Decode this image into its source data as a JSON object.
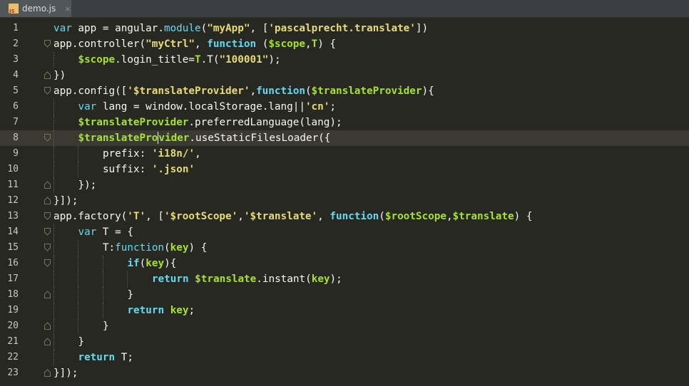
{
  "tab": {
    "filename": "demo.js",
    "close": "×",
    "icon": "js-file-icon"
  },
  "colors": {
    "background": "#272822",
    "keyword": "#66d9ef",
    "string": "#e6db74",
    "variable": "#a6e22e",
    "control": "#f92672",
    "text": "#f8f8f2"
  },
  "current_line": 8,
  "lines": [
    {
      "n": "1",
      "indent": 0,
      "fold": "",
      "tokens": [
        [
          "kw",
          "var"
        ],
        [
          "pl",
          " app = angular."
        ],
        [
          "kw",
          "module"
        ],
        [
          "pl",
          "("
        ],
        [
          "strb",
          "\"myApp\""
        ],
        [
          "pl",
          ", ["
        ],
        [
          "strb",
          "'pascalprecht.translate'"
        ],
        [
          "pl",
          "])"
        ]
      ]
    },
    {
      "n": "2",
      "indent": 0,
      "fold": "open",
      "tokens": [
        [
          "pl",
          "app.controller("
        ],
        [
          "strb",
          "\"myCtrl\""
        ],
        [
          "pl",
          ", "
        ],
        [
          "kwb",
          "function"
        ],
        [
          "pl",
          " ("
        ],
        [
          "varb",
          "$scope"
        ],
        [
          "pl",
          ","
        ],
        [
          "varb",
          "T"
        ],
        [
          "pl",
          ") {"
        ]
      ]
    },
    {
      "n": "3",
      "indent": 1,
      "fold": "",
      "tokens": [
        [
          "varb",
          "$scope"
        ],
        [
          "pl",
          ".login_title="
        ],
        [
          "varb",
          "T"
        ],
        [
          "pl",
          ".T("
        ],
        [
          "strb",
          "\"100001\""
        ],
        [
          "pl",
          ");"
        ]
      ]
    },
    {
      "n": "4",
      "indent": 0,
      "fold": "close",
      "tokens": [
        [
          "pl",
          "})"
        ]
      ]
    },
    {
      "n": "5",
      "indent": 0,
      "fold": "open",
      "tokens": [
        [
          "pl",
          "app.config(["
        ],
        [
          "strb",
          "'$translateProvider'"
        ],
        [
          "pl",
          ","
        ],
        [
          "kwb",
          "function"
        ],
        [
          "pl",
          "("
        ],
        [
          "varb",
          "$translateProvider"
        ],
        [
          "pl",
          "){"
        ]
      ]
    },
    {
      "n": "6",
      "indent": 1,
      "fold": "",
      "tokens": [
        [
          "kw",
          "var"
        ],
        [
          "pl",
          " lang = window.localStorage.lang||"
        ],
        [
          "strb",
          "'cn'"
        ],
        [
          "pl",
          ";"
        ]
      ]
    },
    {
      "n": "7",
      "indent": 1,
      "fold": "",
      "tokens": [
        [
          "varb",
          "$translateProvider"
        ],
        [
          "pl",
          ".preferredLanguage(lang);"
        ]
      ]
    },
    {
      "n": "8",
      "indent": 1,
      "fold": "open",
      "tokens": [
        [
          "varb",
          "$translatePro"
        ],
        [
          "caret",
          ""
        ],
        [
          "varb",
          "vider"
        ],
        [
          "pl",
          ".useStaticFilesLoader({"
        ]
      ]
    },
    {
      "n": "9",
      "indent": 2,
      "fold": "",
      "tokens": [
        [
          "pl",
          "prefix: "
        ],
        [
          "strb",
          "'i18n/'"
        ],
        [
          "pl",
          ","
        ]
      ]
    },
    {
      "n": "10",
      "indent": 2,
      "fold": "",
      "tokens": [
        [
          "pl",
          "suffix: "
        ],
        [
          "strb",
          "'.json'"
        ]
      ]
    },
    {
      "n": "11",
      "indent": 1,
      "fold": "close",
      "tokens": [
        [
          "pl",
          "});"
        ]
      ]
    },
    {
      "n": "12",
      "indent": 0,
      "fold": "close",
      "tokens": [
        [
          "pl",
          "}]);"
        ]
      ]
    },
    {
      "n": "13",
      "indent": 0,
      "fold": "open",
      "tokens": [
        [
          "pl",
          "app.factory("
        ],
        [
          "strb",
          "'T'"
        ],
        [
          "pl",
          ", ["
        ],
        [
          "strb",
          "'$rootScope'"
        ],
        [
          "pl",
          ","
        ],
        [
          "strb",
          "'$translate'"
        ],
        [
          "pl",
          ", "
        ],
        [
          "kwb",
          "function"
        ],
        [
          "pl",
          "("
        ],
        [
          "varb",
          "$rootScope"
        ],
        [
          "pl",
          ","
        ],
        [
          "varb",
          "$translate"
        ],
        [
          "pl",
          ") {"
        ]
      ]
    },
    {
      "n": "14",
      "indent": 1,
      "fold": "open",
      "tokens": [
        [
          "kw",
          "var"
        ],
        [
          "pl",
          " T = {"
        ]
      ]
    },
    {
      "n": "15",
      "indent": 2,
      "fold": "open",
      "tokens": [
        [
          "pl",
          "T:"
        ],
        [
          "kw",
          "function"
        ],
        [
          "pl",
          "("
        ],
        [
          "varb",
          "key"
        ],
        [
          "pl",
          ") {"
        ]
      ]
    },
    {
      "n": "16",
      "indent": 3,
      "fold": "open",
      "tokens": [
        [
          "kwb",
          "if"
        ],
        [
          "pl",
          "("
        ],
        [
          "varb",
          "key"
        ],
        [
          "pl",
          "){"
        ]
      ]
    },
    {
      "n": "17",
      "indent": 4,
      "fold": "",
      "tokens": [
        [
          "kwb",
          "return"
        ],
        [
          "pl",
          " "
        ],
        [
          "varb",
          "$translate"
        ],
        [
          "pl",
          ".instant("
        ],
        [
          "varb",
          "key"
        ],
        [
          "pl",
          ");"
        ]
      ]
    },
    {
      "n": "18",
      "indent": 3,
      "fold": "close",
      "tokens": [
        [
          "pl",
          "}"
        ]
      ]
    },
    {
      "n": "19",
      "indent": 3,
      "fold": "",
      "tokens": [
        [
          "kwb",
          "return"
        ],
        [
          "pl",
          " "
        ],
        [
          "varb",
          "key"
        ],
        [
          "pl",
          ";"
        ]
      ]
    },
    {
      "n": "20",
      "indent": 2,
      "fold": "close",
      "tokens": [
        [
          "pl",
          "}"
        ]
      ]
    },
    {
      "n": "21",
      "indent": 1,
      "fold": "close",
      "tokens": [
        [
          "pl",
          "}"
        ]
      ]
    },
    {
      "n": "22",
      "indent": 1,
      "fold": "",
      "tokens": [
        [
          "kwb",
          "return"
        ],
        [
          "pl",
          " T;"
        ]
      ]
    },
    {
      "n": "23",
      "indent": 0,
      "fold": "close",
      "tokens": [
        [
          "pl",
          "}]);"
        ]
      ]
    }
  ]
}
